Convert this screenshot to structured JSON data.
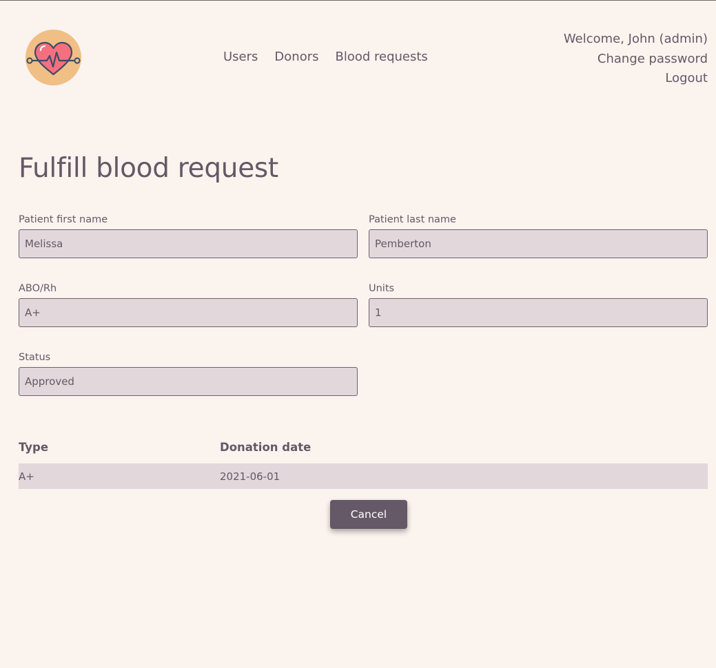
{
  "header": {
    "nav": [
      "Users",
      "Donors",
      "Blood requests"
    ],
    "user_menu": {
      "welcome": "Welcome, John (admin)",
      "change_password": "Change password",
      "logout": "Logout"
    },
    "logo_icon": "heartbeat-heart-icon"
  },
  "page": {
    "title": "Fulfill blood request"
  },
  "form": {
    "first_name": {
      "label": "Patient first name",
      "value": "Melissa"
    },
    "last_name": {
      "label": "Patient last name",
      "value": "Pemberton"
    },
    "abo_rh": {
      "label": "ABO/Rh",
      "value": "A+"
    },
    "units": {
      "label": "Units",
      "value": "1"
    },
    "status": {
      "label": "Status",
      "value": "Approved"
    }
  },
  "table": {
    "headers": [
      "Type",
      "Donation date"
    ],
    "rows": [
      [
        "A+",
        "2021-06-01"
      ]
    ]
  },
  "actions": {
    "cancel": "Cancel"
  },
  "colors": {
    "background": "#fbf3ee",
    "text": "#655867",
    "input_bg": "#e2d7da",
    "button_bg": "#655867",
    "logo_circle": "#efbf86",
    "heart": "#f4707e"
  }
}
